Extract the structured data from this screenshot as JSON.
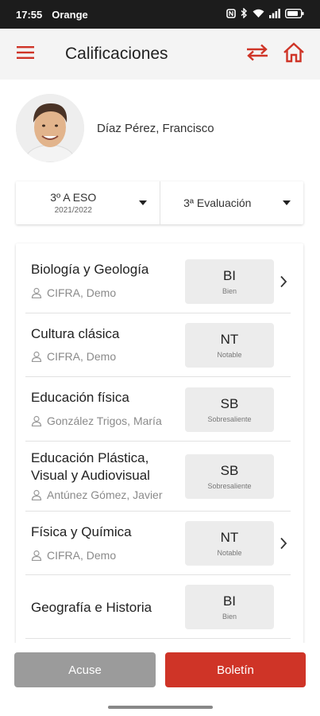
{
  "status": {
    "time": "17:55",
    "carrier": "Orange"
  },
  "header": {
    "title": "Calificaciones"
  },
  "student": {
    "name": "Díaz Pérez, Francisco"
  },
  "selectors": {
    "group": {
      "label": "3º A ESO",
      "year": "2021/2022"
    },
    "evaluation": {
      "label": "3ª Evaluación"
    }
  },
  "subjects": [
    {
      "name": "Biología y Geología",
      "teacher": "CIFRA, Demo",
      "grade": "BI",
      "grade_desc": "Bien",
      "has_detail": true
    },
    {
      "name": "Cultura clásica",
      "teacher": "CIFRA, Demo",
      "grade": "NT",
      "grade_desc": "Notable",
      "has_detail": false
    },
    {
      "name": "Educación física",
      "teacher": "González Trigos, María",
      "grade": "SB",
      "grade_desc": "Sobresaliente",
      "has_detail": false
    },
    {
      "name": "Educación Plástica, Visual y Audiovisual",
      "teacher": "Antúnez Gómez, Javier",
      "grade": "SB",
      "grade_desc": "Sobresaliente",
      "has_detail": false
    },
    {
      "name": "Física y Química",
      "teacher": "CIFRA, Demo",
      "grade": "NT",
      "grade_desc": "Notable",
      "has_detail": true
    },
    {
      "name": "Geografía e Historia",
      "teacher": "",
      "grade": "BI",
      "grade_desc": "Bien",
      "has_detail": false
    }
  ],
  "buttons": {
    "acuse": "Acuse",
    "boletin": "Boletín"
  },
  "colors": {
    "accent": "#cf3427",
    "secondary_button": "#9b9b9b",
    "appbar": "#f4f4f4"
  },
  "icons": {
    "menu": "menu-icon",
    "switch": "swap-arrows-icon",
    "home": "home-icon",
    "teacher": "person-icon",
    "detail": "chevron-right-icon"
  }
}
